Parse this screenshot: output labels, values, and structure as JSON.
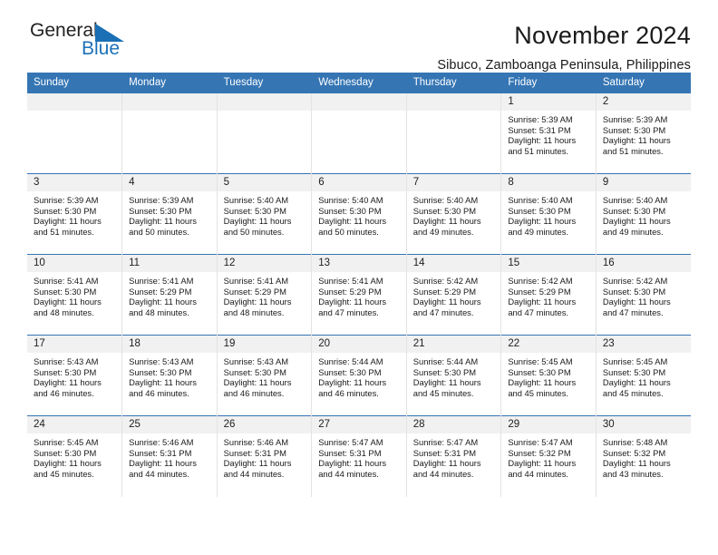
{
  "brand": {
    "name_part1": "General",
    "name_part2": "Blue",
    "accent_color": "#1a6fb5",
    "triangle_icon": "triangle-icon"
  },
  "header": {
    "month_title": "November 2024",
    "location": "Sibuco, Zamboanga Peninsula, Philippines"
  },
  "calendar": {
    "header_color": "#3575b4",
    "daynum_band_color": "#f1f1f1",
    "weekday_headers": [
      "Sunday",
      "Monday",
      "Tuesday",
      "Wednesday",
      "Thursday",
      "Friday",
      "Saturday"
    ],
    "weeks": [
      [
        {
          "day": "",
          "blank": true,
          "sunrise": "",
          "sunset": "",
          "daylight_line1": "",
          "daylight_line2": ""
        },
        {
          "day": "",
          "blank": true,
          "sunrise": "",
          "sunset": "",
          "daylight_line1": "",
          "daylight_line2": ""
        },
        {
          "day": "",
          "blank": true,
          "sunrise": "",
          "sunset": "",
          "daylight_line1": "",
          "daylight_line2": ""
        },
        {
          "day": "",
          "blank": true,
          "sunrise": "",
          "sunset": "",
          "daylight_line1": "",
          "daylight_line2": ""
        },
        {
          "day": "",
          "blank": true,
          "sunrise": "",
          "sunset": "",
          "daylight_line1": "",
          "daylight_line2": ""
        },
        {
          "day": "1",
          "blank": false,
          "sunrise": "Sunrise: 5:39 AM",
          "sunset": "Sunset: 5:31 PM",
          "daylight_line1": "Daylight: 11 hours",
          "daylight_line2": "and 51 minutes."
        },
        {
          "day": "2",
          "blank": false,
          "sunrise": "Sunrise: 5:39 AM",
          "sunset": "Sunset: 5:30 PM",
          "daylight_line1": "Daylight: 11 hours",
          "daylight_line2": "and 51 minutes."
        }
      ],
      [
        {
          "day": "3",
          "blank": false,
          "sunrise": "Sunrise: 5:39 AM",
          "sunset": "Sunset: 5:30 PM",
          "daylight_line1": "Daylight: 11 hours",
          "daylight_line2": "and 51 minutes."
        },
        {
          "day": "4",
          "blank": false,
          "sunrise": "Sunrise: 5:39 AM",
          "sunset": "Sunset: 5:30 PM",
          "daylight_line1": "Daylight: 11 hours",
          "daylight_line2": "and 50 minutes."
        },
        {
          "day": "5",
          "blank": false,
          "sunrise": "Sunrise: 5:40 AM",
          "sunset": "Sunset: 5:30 PM",
          "daylight_line1": "Daylight: 11 hours",
          "daylight_line2": "and 50 minutes."
        },
        {
          "day": "6",
          "blank": false,
          "sunrise": "Sunrise: 5:40 AM",
          "sunset": "Sunset: 5:30 PM",
          "daylight_line1": "Daylight: 11 hours",
          "daylight_line2": "and 50 minutes."
        },
        {
          "day": "7",
          "blank": false,
          "sunrise": "Sunrise: 5:40 AM",
          "sunset": "Sunset: 5:30 PM",
          "daylight_line1": "Daylight: 11 hours",
          "daylight_line2": "and 49 minutes."
        },
        {
          "day": "8",
          "blank": false,
          "sunrise": "Sunrise: 5:40 AM",
          "sunset": "Sunset: 5:30 PM",
          "daylight_line1": "Daylight: 11 hours",
          "daylight_line2": "and 49 minutes."
        },
        {
          "day": "9",
          "blank": false,
          "sunrise": "Sunrise: 5:40 AM",
          "sunset": "Sunset: 5:30 PM",
          "daylight_line1": "Daylight: 11 hours",
          "daylight_line2": "and 49 minutes."
        }
      ],
      [
        {
          "day": "10",
          "blank": false,
          "sunrise": "Sunrise: 5:41 AM",
          "sunset": "Sunset: 5:30 PM",
          "daylight_line1": "Daylight: 11 hours",
          "daylight_line2": "and 48 minutes."
        },
        {
          "day": "11",
          "blank": false,
          "sunrise": "Sunrise: 5:41 AM",
          "sunset": "Sunset: 5:29 PM",
          "daylight_line1": "Daylight: 11 hours",
          "daylight_line2": "and 48 minutes."
        },
        {
          "day": "12",
          "blank": false,
          "sunrise": "Sunrise: 5:41 AM",
          "sunset": "Sunset: 5:29 PM",
          "daylight_line1": "Daylight: 11 hours",
          "daylight_line2": "and 48 minutes."
        },
        {
          "day": "13",
          "blank": false,
          "sunrise": "Sunrise: 5:41 AM",
          "sunset": "Sunset: 5:29 PM",
          "daylight_line1": "Daylight: 11 hours",
          "daylight_line2": "and 47 minutes."
        },
        {
          "day": "14",
          "blank": false,
          "sunrise": "Sunrise: 5:42 AM",
          "sunset": "Sunset: 5:29 PM",
          "daylight_line1": "Daylight: 11 hours",
          "daylight_line2": "and 47 minutes."
        },
        {
          "day": "15",
          "blank": false,
          "sunrise": "Sunrise: 5:42 AM",
          "sunset": "Sunset: 5:29 PM",
          "daylight_line1": "Daylight: 11 hours",
          "daylight_line2": "and 47 minutes."
        },
        {
          "day": "16",
          "blank": false,
          "sunrise": "Sunrise: 5:42 AM",
          "sunset": "Sunset: 5:30 PM",
          "daylight_line1": "Daylight: 11 hours",
          "daylight_line2": "and 47 minutes."
        }
      ],
      [
        {
          "day": "17",
          "blank": false,
          "sunrise": "Sunrise: 5:43 AM",
          "sunset": "Sunset: 5:30 PM",
          "daylight_line1": "Daylight: 11 hours",
          "daylight_line2": "and 46 minutes."
        },
        {
          "day": "18",
          "blank": false,
          "sunrise": "Sunrise: 5:43 AM",
          "sunset": "Sunset: 5:30 PM",
          "daylight_line1": "Daylight: 11 hours",
          "daylight_line2": "and 46 minutes."
        },
        {
          "day": "19",
          "blank": false,
          "sunrise": "Sunrise: 5:43 AM",
          "sunset": "Sunset: 5:30 PM",
          "daylight_line1": "Daylight: 11 hours",
          "daylight_line2": "and 46 minutes."
        },
        {
          "day": "20",
          "blank": false,
          "sunrise": "Sunrise: 5:44 AM",
          "sunset": "Sunset: 5:30 PM",
          "daylight_line1": "Daylight: 11 hours",
          "daylight_line2": "and 46 minutes."
        },
        {
          "day": "21",
          "blank": false,
          "sunrise": "Sunrise: 5:44 AM",
          "sunset": "Sunset: 5:30 PM",
          "daylight_line1": "Daylight: 11 hours",
          "daylight_line2": "and 45 minutes."
        },
        {
          "day": "22",
          "blank": false,
          "sunrise": "Sunrise: 5:45 AM",
          "sunset": "Sunset: 5:30 PM",
          "daylight_line1": "Daylight: 11 hours",
          "daylight_line2": "and 45 minutes."
        },
        {
          "day": "23",
          "blank": false,
          "sunrise": "Sunrise: 5:45 AM",
          "sunset": "Sunset: 5:30 PM",
          "daylight_line1": "Daylight: 11 hours",
          "daylight_line2": "and 45 minutes."
        }
      ],
      [
        {
          "day": "24",
          "blank": false,
          "sunrise": "Sunrise: 5:45 AM",
          "sunset": "Sunset: 5:30 PM",
          "daylight_line1": "Daylight: 11 hours",
          "daylight_line2": "and 45 minutes."
        },
        {
          "day": "25",
          "blank": false,
          "sunrise": "Sunrise: 5:46 AM",
          "sunset": "Sunset: 5:31 PM",
          "daylight_line1": "Daylight: 11 hours",
          "daylight_line2": "and 44 minutes."
        },
        {
          "day": "26",
          "blank": false,
          "sunrise": "Sunrise: 5:46 AM",
          "sunset": "Sunset: 5:31 PM",
          "daylight_line1": "Daylight: 11 hours",
          "daylight_line2": "and 44 minutes."
        },
        {
          "day": "27",
          "blank": false,
          "sunrise": "Sunrise: 5:47 AM",
          "sunset": "Sunset: 5:31 PM",
          "daylight_line1": "Daylight: 11 hours",
          "daylight_line2": "and 44 minutes."
        },
        {
          "day": "28",
          "blank": false,
          "sunrise": "Sunrise: 5:47 AM",
          "sunset": "Sunset: 5:31 PM",
          "daylight_line1": "Daylight: 11 hours",
          "daylight_line2": "and 44 minutes."
        },
        {
          "day": "29",
          "blank": false,
          "sunrise": "Sunrise: 5:47 AM",
          "sunset": "Sunset: 5:32 PM",
          "daylight_line1": "Daylight: 11 hours",
          "daylight_line2": "and 44 minutes."
        },
        {
          "day": "30",
          "blank": false,
          "sunrise": "Sunrise: 5:48 AM",
          "sunset": "Sunset: 5:32 PM",
          "daylight_line1": "Daylight: 11 hours",
          "daylight_line2": "and 43 minutes."
        }
      ]
    ]
  }
}
